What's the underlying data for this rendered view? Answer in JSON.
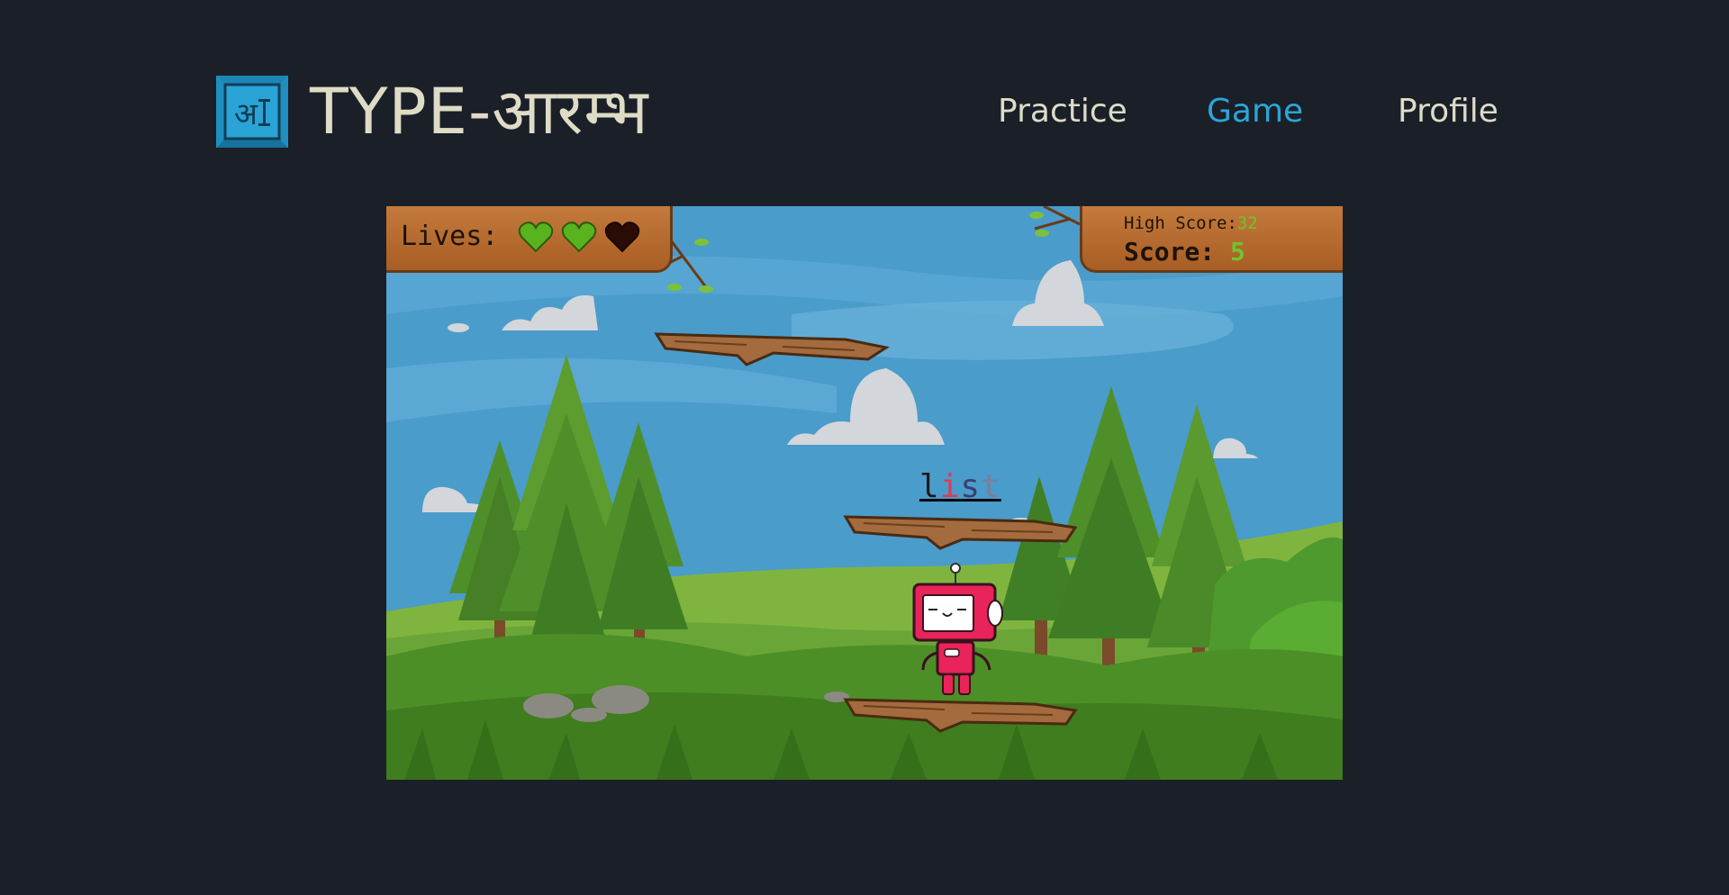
{
  "brand": {
    "logo_glyph": "अ",
    "title": "TYPE-आरम्भ",
    "accent_color": "#2ba6d8"
  },
  "nav": {
    "items": [
      {
        "label": "Practice",
        "active": false
      },
      {
        "label": "Game",
        "active": true
      },
      {
        "label": "Profile",
        "active": false
      }
    ]
  },
  "game": {
    "lives_label": "Lives:",
    "lives_total": 3,
    "lives_remaining": 2,
    "high_score_label": "High Score:",
    "high_score_value": "32",
    "score_label": "Score:",
    "score_value": "5",
    "current_word": {
      "typed": "l",
      "current": "i",
      "pending": "s",
      "rest": "t"
    },
    "character": "robot"
  }
}
